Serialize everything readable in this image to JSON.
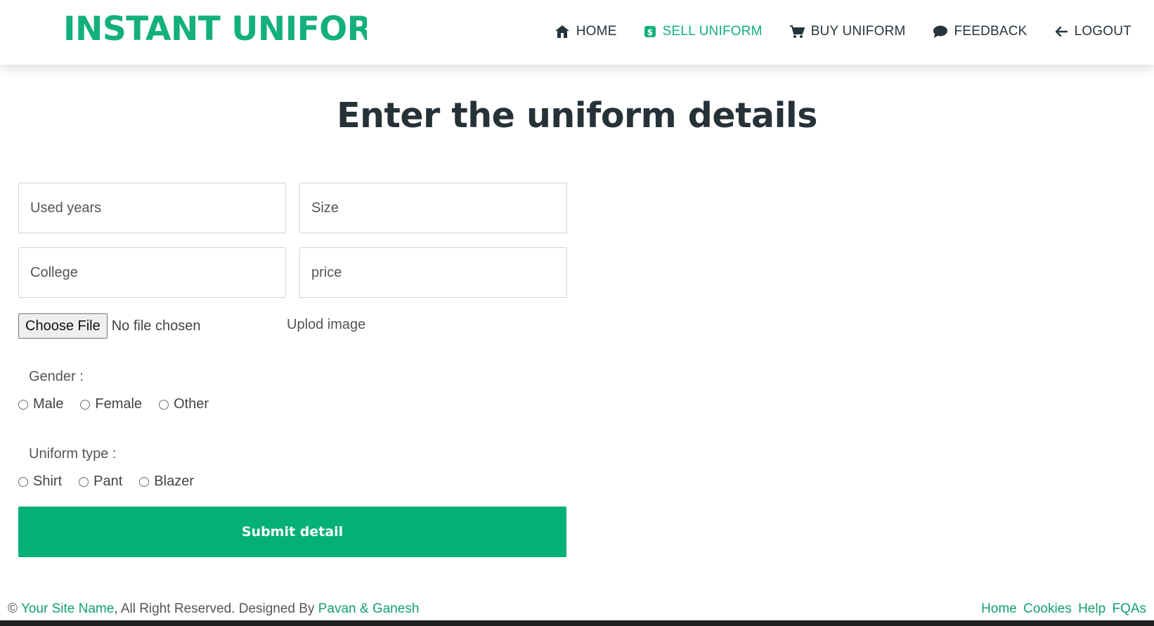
{
  "header": {
    "logo": "INSTANT UNIFORM",
    "nav": [
      {
        "label": "HOME",
        "icon": "home-icon"
      },
      {
        "label": "SELL UNIFORM",
        "icon": "dollar-square-icon",
        "active": true
      },
      {
        "label": "BUY UNIFORM",
        "icon": "cart-icon"
      },
      {
        "label": "FEEDBACK",
        "icon": "chat-bubble-icon"
      },
      {
        "label": "LOGOUT",
        "icon": "arrow-left-icon"
      }
    ]
  },
  "main": {
    "title": "Enter the uniform details",
    "fields": {
      "used_years": "Used years",
      "size": "Size",
      "college": "College",
      "price": "price"
    },
    "file": {
      "button": "Choose File",
      "status": "No file chosen",
      "label": "Uplod image"
    },
    "gender": {
      "label": "Gender :",
      "options": [
        "Male",
        "Female",
        "Other"
      ]
    },
    "uniform_type": {
      "label": "Uniform type :",
      "options": [
        "Shirt",
        "Pant",
        "Blazer"
      ]
    },
    "submit": "Submit detail"
  },
  "footer": {
    "copyright_symbol": "©",
    "site_name": "Your Site Name",
    "rights": ", All Right Reserved. Designed By ",
    "designers": "Pavan & Ganesh",
    "links": [
      "Home",
      "Cookies",
      "Help",
      "FQAs"
    ]
  },
  "colors": {
    "accent": "#12b07a",
    "submit": "#03b077",
    "heading": "#263238"
  }
}
